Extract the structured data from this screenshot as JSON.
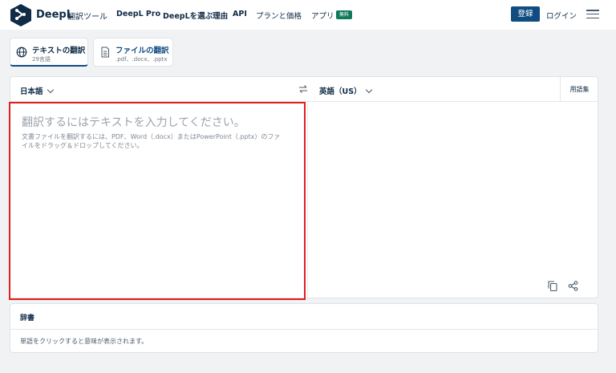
{
  "header": {
    "brand": "DeepL",
    "brand_sub": "翻訳ツール",
    "nav": [
      "DeepL Pro",
      "DeepLを選ぶ理由",
      "API",
      "プランと価格",
      "アプリ"
    ],
    "badge": "無料",
    "signup": "登録",
    "login": "ログイン"
  },
  "tabs": {
    "text": {
      "title": "テキストの翻訳",
      "sub": "29言語"
    },
    "file": {
      "title": "ファイルの翻訳",
      "sub": ".pdf、.docx、.pptx"
    }
  },
  "translator": {
    "source_lang": "日本語",
    "target_lang": "英語（US）",
    "glossary": "用語集",
    "placeholder": "翻訳するにはテキストを入力してください。",
    "hint": "文書ファイルを翻訳するには、PDF、Word（.docx）またはPowerPoint（.pptx）のファイルをドラッグ＆ドロップしてください。"
  },
  "dictionary": {
    "title": "辞書",
    "hint": "単語をクリックすると意味が表示されます。"
  },
  "colors": {
    "brand": "#0f2b46",
    "accent": "#0f4c81",
    "badge": "#0f7a5a",
    "highlight": "#e0201f"
  }
}
